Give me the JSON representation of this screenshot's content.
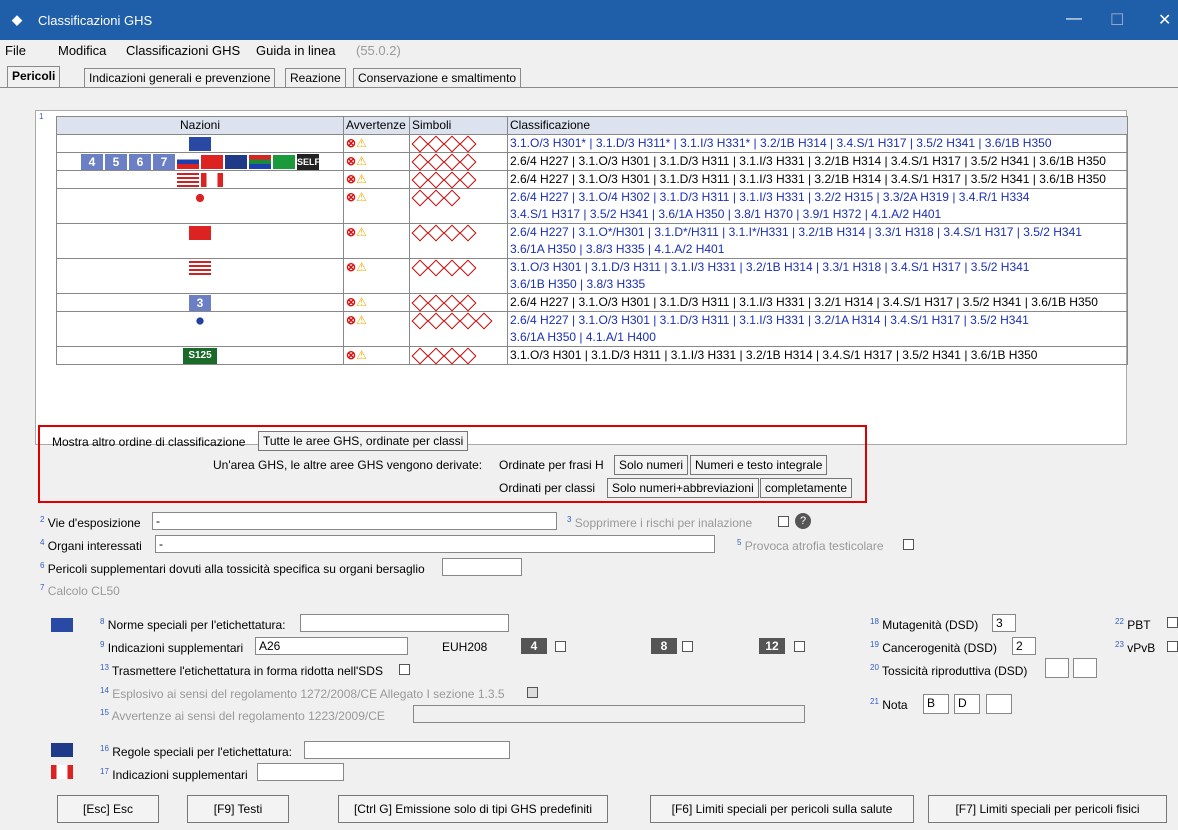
{
  "window": {
    "title": "Classificazioni GHS",
    "min": "—",
    "max": "☐",
    "close": "✕"
  },
  "menu": {
    "file": "File",
    "modifica": "Modifica",
    "classificazioni": "Classificazioni GHS",
    "guida": "Guida in linea",
    "version": "(55.0.2)"
  },
  "tabs": [
    "Pericoli",
    "Indicazioni generali e prevenzione",
    "Reazione",
    "Conservazione e smaltimento"
  ],
  "grid": {
    "row_marker": "1",
    "headers": [
      "Nazioni",
      "Avvertenze",
      "Simboli",
      "Classificazione"
    ],
    "rows": [
      {
        "nations": "EU",
        "cls_a": "3.1.O/3 H301* | 3.1.D/3 H311* | 3.1.I/3 H331* | 3.2/1B H314 | 3.4.S/1 H317 | 3.5/2 H341 | 3.6/1B H350",
        "cls_b": ""
      },
      {
        "nations": "4 5 6 7 RU TW AU ZA BR SELF",
        "cls_a": "2.6/4 H227 | 3.1.O/3 H301 | 3.1.D/3 H311 | 3.1.I/3 H331 | 3.2/1B H314 | 3.4.S/1 H317 | 3.5/2 H341 | 3.6/1B H350",
        "cls_b": ""
      },
      {
        "nations": "US CA",
        "cls_a": "2.6/4 H227 | 3.1.O/3 H301 | 3.1.D/3 H311 | 3.1.I/3 H331 | 3.2/1B H314 | 3.4.S/1 H317 | 3.5/2 H341 | 3.6/1B H350",
        "cls_b": ""
      },
      {
        "nations": "JP",
        "cls_a": "2.6/4 H227 | 3.1.O/4 H302 | 3.1.D/3 H311 | 3.1.I/3 H331 | 3.2/2 H315 | 3.3/2A H319 | 3.4.R/1 H334",
        "cls_b": "3.4.S/1 H317 | 3.5/2 H341 | 3.6/1A H350 | 3.8/1 H370 | 3.9/1 H372 | 4.1.A/2 H401"
      },
      {
        "nations": "CN",
        "cls_a": "2.6/4 H227 | 3.1.O*/H301 | 3.1.D*/H311 | 3.1.I*/H331 | 3.2/1B H314 | 3.3/1 H318 | 3.4.S/1 H317 | 3.5/2 H341",
        "cls_b": "3.6/1A H350 | 3.8/3 H335 | 4.1.A/2 H401"
      },
      {
        "nations": "MY",
        "cls_a": "3.1.O/3 H301 | 3.1.D/3 H311 | 3.1.I/3 H331 | 3.2/1B H314 | 3.3/1 H318 | 3.4.S/1 H317 | 3.5/2 H341",
        "cls_b": "3.6/1B H350 | 3.8/3 H335"
      },
      {
        "nations": "3",
        "cls_a": "2.6/4 H227 | 3.1.O/3 H301 | 3.1.D/3 H311 | 3.1.I/3 H331 | 3.2/1 H314 | 3.4.S/1 H317 | 3.5/2 H341 | 3.6/1B H350",
        "cls_b": ""
      },
      {
        "nations": "KR",
        "cls_a": "2.6/4 H227 | 3.1.O/3 H301 | 3.1.D/3 H311 | 3.1.I/3 H331 | 3.2/1A H314 | 3.4.S/1 H317 | 3.5/2 H341",
        "cls_b": "3.6/1A H350 | 4.1.A/1 H400"
      },
      {
        "nations": "S125",
        "cls_a": "3.1.O/3 H301 | 3.1.D/3 H311 | 3.1.I/3 H331 | 3.2/1B H314 | 3.4.S/1 H317 | 3.5/2 H341 | 3.6/1B H350",
        "cls_b": ""
      }
    ]
  },
  "order": {
    "label1": "Mostra altro ordine di classificazione",
    "btn_all": "Tutte le aree GHS, ordinate per classi",
    "label2": "Un'area GHS, le altre aree GHS vengono derivate:",
    "label3": "Ordinate per frasi H",
    "btn_num": "Solo numeri",
    "btn_full": "Numeri e testo integrale",
    "label4": "Ordinati per classi",
    "btn_abbr": "Solo numeri+abbreviazioni",
    "btn_comp": "completamente"
  },
  "fields": {
    "vie": "Vie d'esposizione",
    "vie_val": "-",
    "sopp": "Sopprimere i rischi per inalazione",
    "organi": "Organi interessati",
    "organi_val": "-",
    "atrofia": "Provoca atrofia testicolare",
    "pericoli": "Pericoli supplementari dovuti alla tossicità specifica su organi bersaglio",
    "cl50": "Calcolo CL50",
    "norme": "Norme speciali per l'etichettatura:",
    "ind": "Indicazioni supplementari",
    "ind_val": "A26",
    "euh": "EUH208",
    "n4": "4",
    "n8": "8",
    "n12": "12",
    "trasm": "Trasmettere l'etichettatura in forma ridotta nell'SDS",
    "espl": "Esplosivo ai sensi del regolamento 1272/2008/CE Allegato I sezione 1.3.5",
    "avv": "Avvertenze ai sensi del regolamento 1223/2009/CE",
    "mut": "Mutagenità (DSD)",
    "mut_val": "3",
    "canc": "Cancerogenità (DSD)",
    "canc_val": "2",
    "tox": "Tossicità riproduttiva (DSD)",
    "nota": "Nota",
    "nota_b": "B",
    "nota_d": "D",
    "pbt": "PBT",
    "vpvb": "vPvB",
    "regole": "Regole speciali per l'etichettatura:",
    "ind2": "Indicazioni supplementari"
  },
  "buttons": {
    "esc": "[Esc] Esc",
    "testi": "[F9] Testi",
    "ctrlg": "[Ctrl G] Emissione solo di tipi GHS predefiniti",
    "f6": "[F6] Limiti speciali per pericoli sulla salute",
    "f7": "[F7] Limiti speciali per pericoli fisici"
  }
}
